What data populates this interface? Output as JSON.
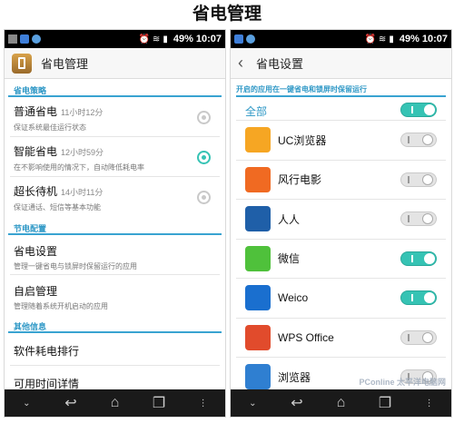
{
  "caption": "省电管理",
  "status": {
    "battery": "49%",
    "time": "10:07"
  },
  "left": {
    "title": "省电管理",
    "sections": {
      "strategy": "省电策略",
      "config": "节电配置",
      "other": "其他信息"
    },
    "modes": [
      {
        "name": "普通省电",
        "duration": "11小时12分",
        "desc": "保证系统最佳运行状态",
        "selected": false
      },
      {
        "name": "智能省电",
        "duration": "12小时59分",
        "desc": "在不影响使用的情况下，自动降低耗电率",
        "selected": true
      },
      {
        "name": "超长待机",
        "duration": "14小时11分",
        "desc": "保证通话、短信等基本功能",
        "selected": false
      }
    ],
    "config_items": [
      {
        "name": "省电设置",
        "desc": "管理一键省电与锁屏时保留运行的应用"
      },
      {
        "name": "自启管理",
        "desc": "管理随着系统开机启动的应用"
      }
    ],
    "other_items": [
      "软件耗电排行",
      "可用时间详情"
    ]
  },
  "right": {
    "title": "省电设置",
    "header": "开启的应用在一键省电和锁屏时保留运行",
    "all_label": "全部",
    "all_on": true,
    "apps": [
      {
        "name": "UC浏览器",
        "on": false,
        "icon": "uc-browser-icon",
        "color": "#f6a623"
      },
      {
        "name": "风行电影",
        "on": false,
        "icon": "funshion-icon",
        "color": "#f06a22"
      },
      {
        "name": "人人",
        "on": false,
        "icon": "renren-icon",
        "color": "#1f5fa8"
      },
      {
        "name": "微信",
        "on": true,
        "icon": "wechat-icon",
        "color": "#4fc13b"
      },
      {
        "name": "Weico",
        "on": true,
        "icon": "weico-icon",
        "color": "#1a6fcf"
      },
      {
        "name": "WPS Office",
        "on": false,
        "icon": "wps-office-icon",
        "color": "#e14b2c"
      },
      {
        "name": "浏览器",
        "on": false,
        "icon": "browser-icon",
        "color": "#2f7fd1"
      }
    ]
  },
  "watermark": "PConline 太平洋电脑网"
}
